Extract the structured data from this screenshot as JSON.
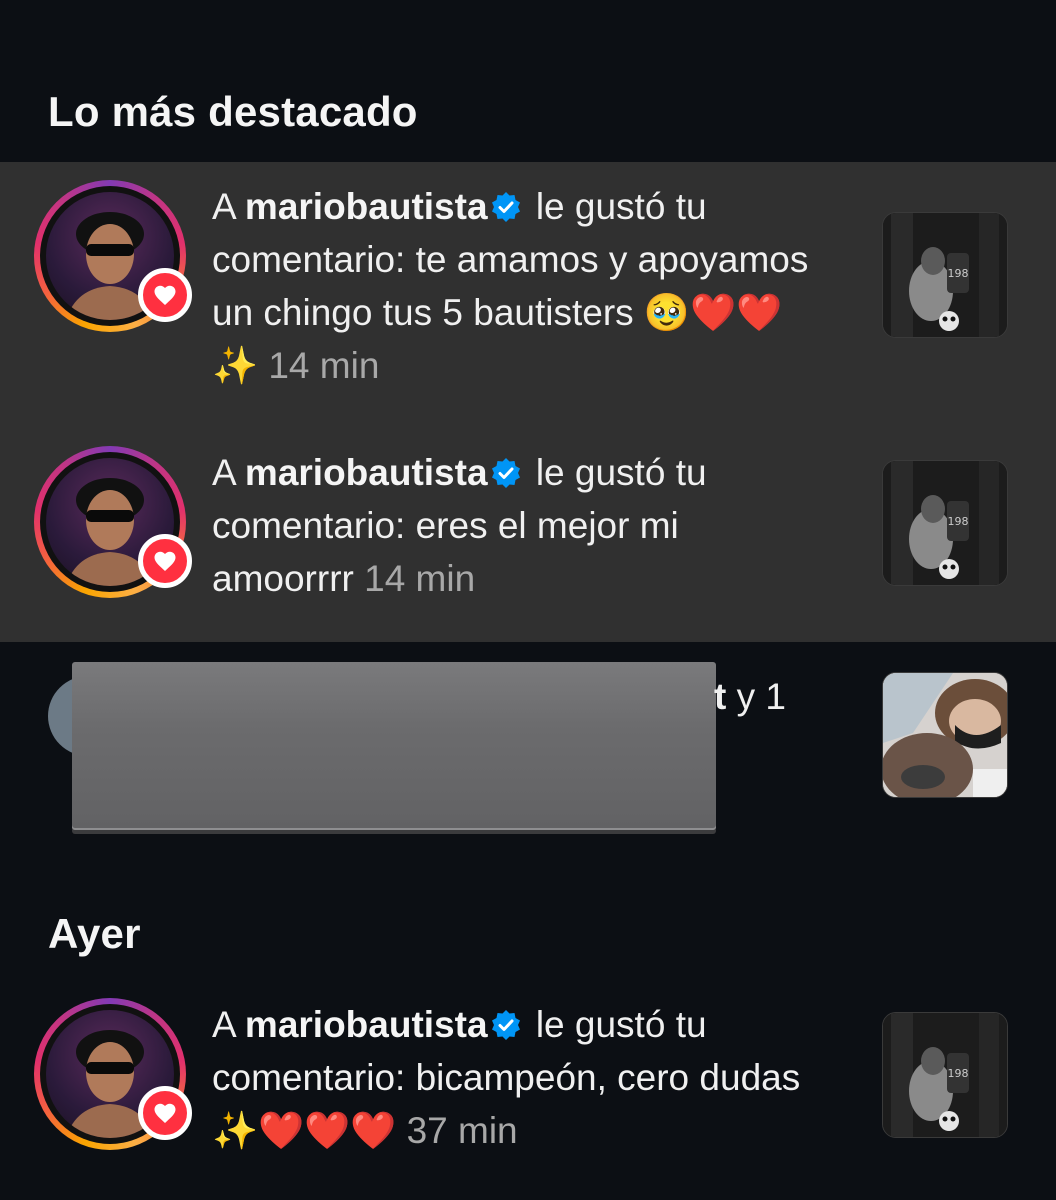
{
  "sections": {
    "highlights_title": "Lo más destacado",
    "yesterday_title": "Ayer"
  },
  "notifications": [
    {
      "prefix": "A",
      "username": "mariobautista",
      "action": "le gustó tu comentario:",
      "comment": "te amamos y apoyamos un chingo tus 5 bautisters 🥹❤️❤️✨",
      "time": "14 min",
      "verified": true,
      "icon": "heart-icon"
    },
    {
      "prefix": "A",
      "username": "mariobautista",
      "action": "le gustó tu comentario:",
      "comment": "eres el mejor mi amoorrrr",
      "time": "14 min",
      "verified": true,
      "icon": "heart-icon"
    },
    {
      "prefix": "A",
      "username": "mariobautista",
      "action": "le gustó tu comentario:",
      "comment": "bicampeón, cero dudas ✨❤️❤️❤️",
      "time": "37 min",
      "verified": true,
      "icon": "heart-icon"
    }
  ],
  "redacted_notification": {
    "visible_fragment_bold": "t",
    "visible_fragment": " y 1"
  },
  "colors": {
    "background": "#0c0f14",
    "highlight_bg": "#303030",
    "like_red": "#ff3040",
    "verified_blue": "#0095f6",
    "time_gray": "#a8a8a8"
  }
}
